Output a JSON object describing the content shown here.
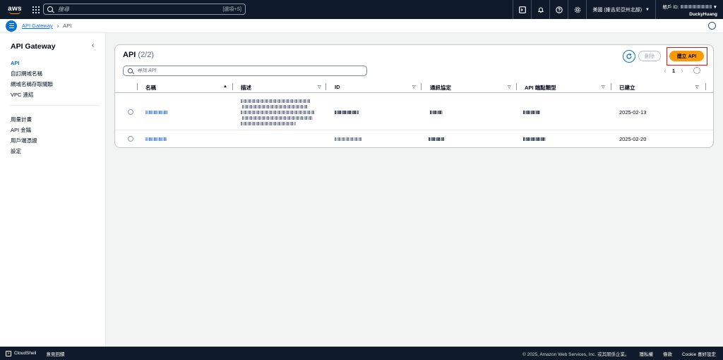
{
  "nav": {
    "logo": "aws",
    "search_placeholder": "搜尋",
    "search_shortcut": "[選項+S]",
    "icons": [
      "cloudshell-icon",
      "bell-icon",
      "help-icon",
      "settings-icon"
    ],
    "region": "美國 (維吉尼亞州北部)",
    "account_prefix": "帳戶 ID:",
    "username": "DuckyHuang"
  },
  "breadcrumb": {
    "parent": "API Gateway",
    "current": "API"
  },
  "sidebar": {
    "title": "API Gateway",
    "primary": [
      "API",
      "自訂網域名稱",
      "網域名稱存取關聯",
      "VPC 連結"
    ],
    "secondary": [
      "用量計畫",
      "API 金鑰",
      "用戶端憑證",
      "設定"
    ]
  },
  "card": {
    "title": "API",
    "count": "(2/2)",
    "delete_label": "刪除",
    "create_label": "建立 API",
    "filter_placeholder": "尋找 API",
    "page": "1",
    "columns": [
      "名稱",
      "描述",
      "ID",
      "通訊協定",
      "API 端點類型",
      "已建立"
    ],
    "rows": [
      {
        "created": "2025-02-13"
      },
      {
        "created": "2025-02-20"
      }
    ]
  },
  "footer": {
    "cloudshell": "CloudShell",
    "feedback": "意見回饋",
    "copyright": "© 2025, Amazon Web Services, Inc. 或其關係企業。",
    "privacy": "隱私權",
    "terms": "條款",
    "cookies": "Cookie 喜好設定"
  },
  "colors": {
    "nav_bg": "#0f1b2a",
    "accent": "#0972d3",
    "primary_button": "#ff9900",
    "highlight_border": "#d91515"
  }
}
